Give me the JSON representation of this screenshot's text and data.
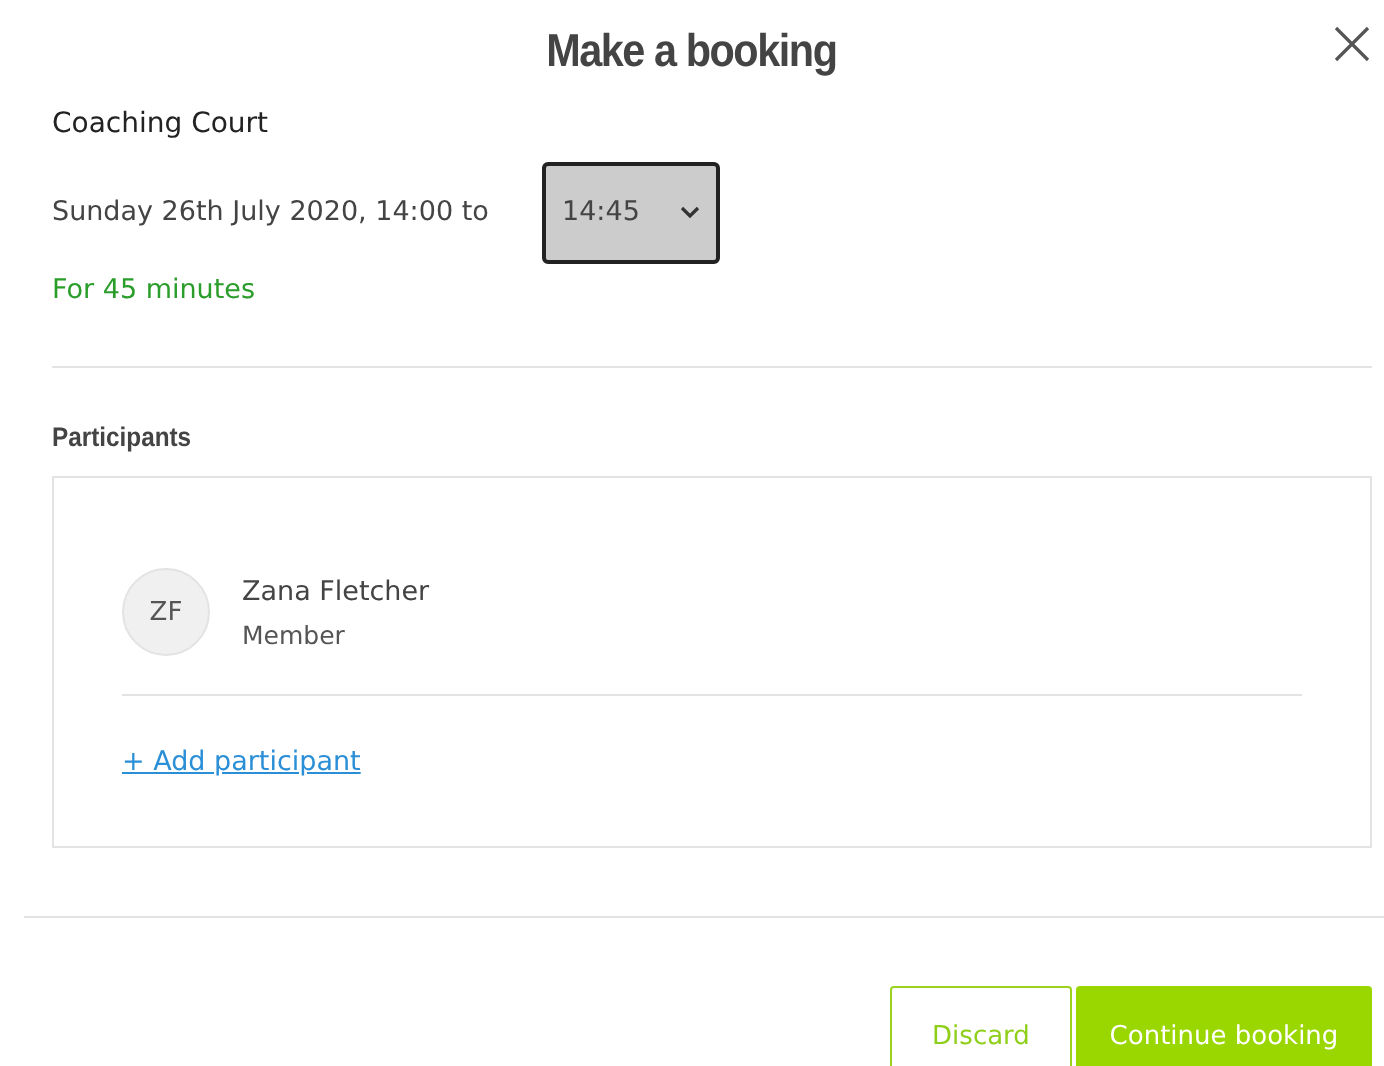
{
  "dialog": {
    "title": "Make a booking"
  },
  "booking": {
    "resource": "Coaching Court",
    "date_text": "Sunday 26th July 2020, 14:00 to",
    "end_time": {
      "value": "14:45"
    },
    "duration": "For 45 minutes"
  },
  "participants": {
    "heading": "Participants",
    "items": [
      {
        "initials": "ZF",
        "name": "Zana Fletcher",
        "role": "Member"
      }
    ],
    "add_link": "+ Add participant"
  },
  "buttons": [
    {
      "label": "Discard",
      "kind": "secondary"
    },
    {
      "label": "Continue booking",
      "kind": "primary"
    }
  ]
}
